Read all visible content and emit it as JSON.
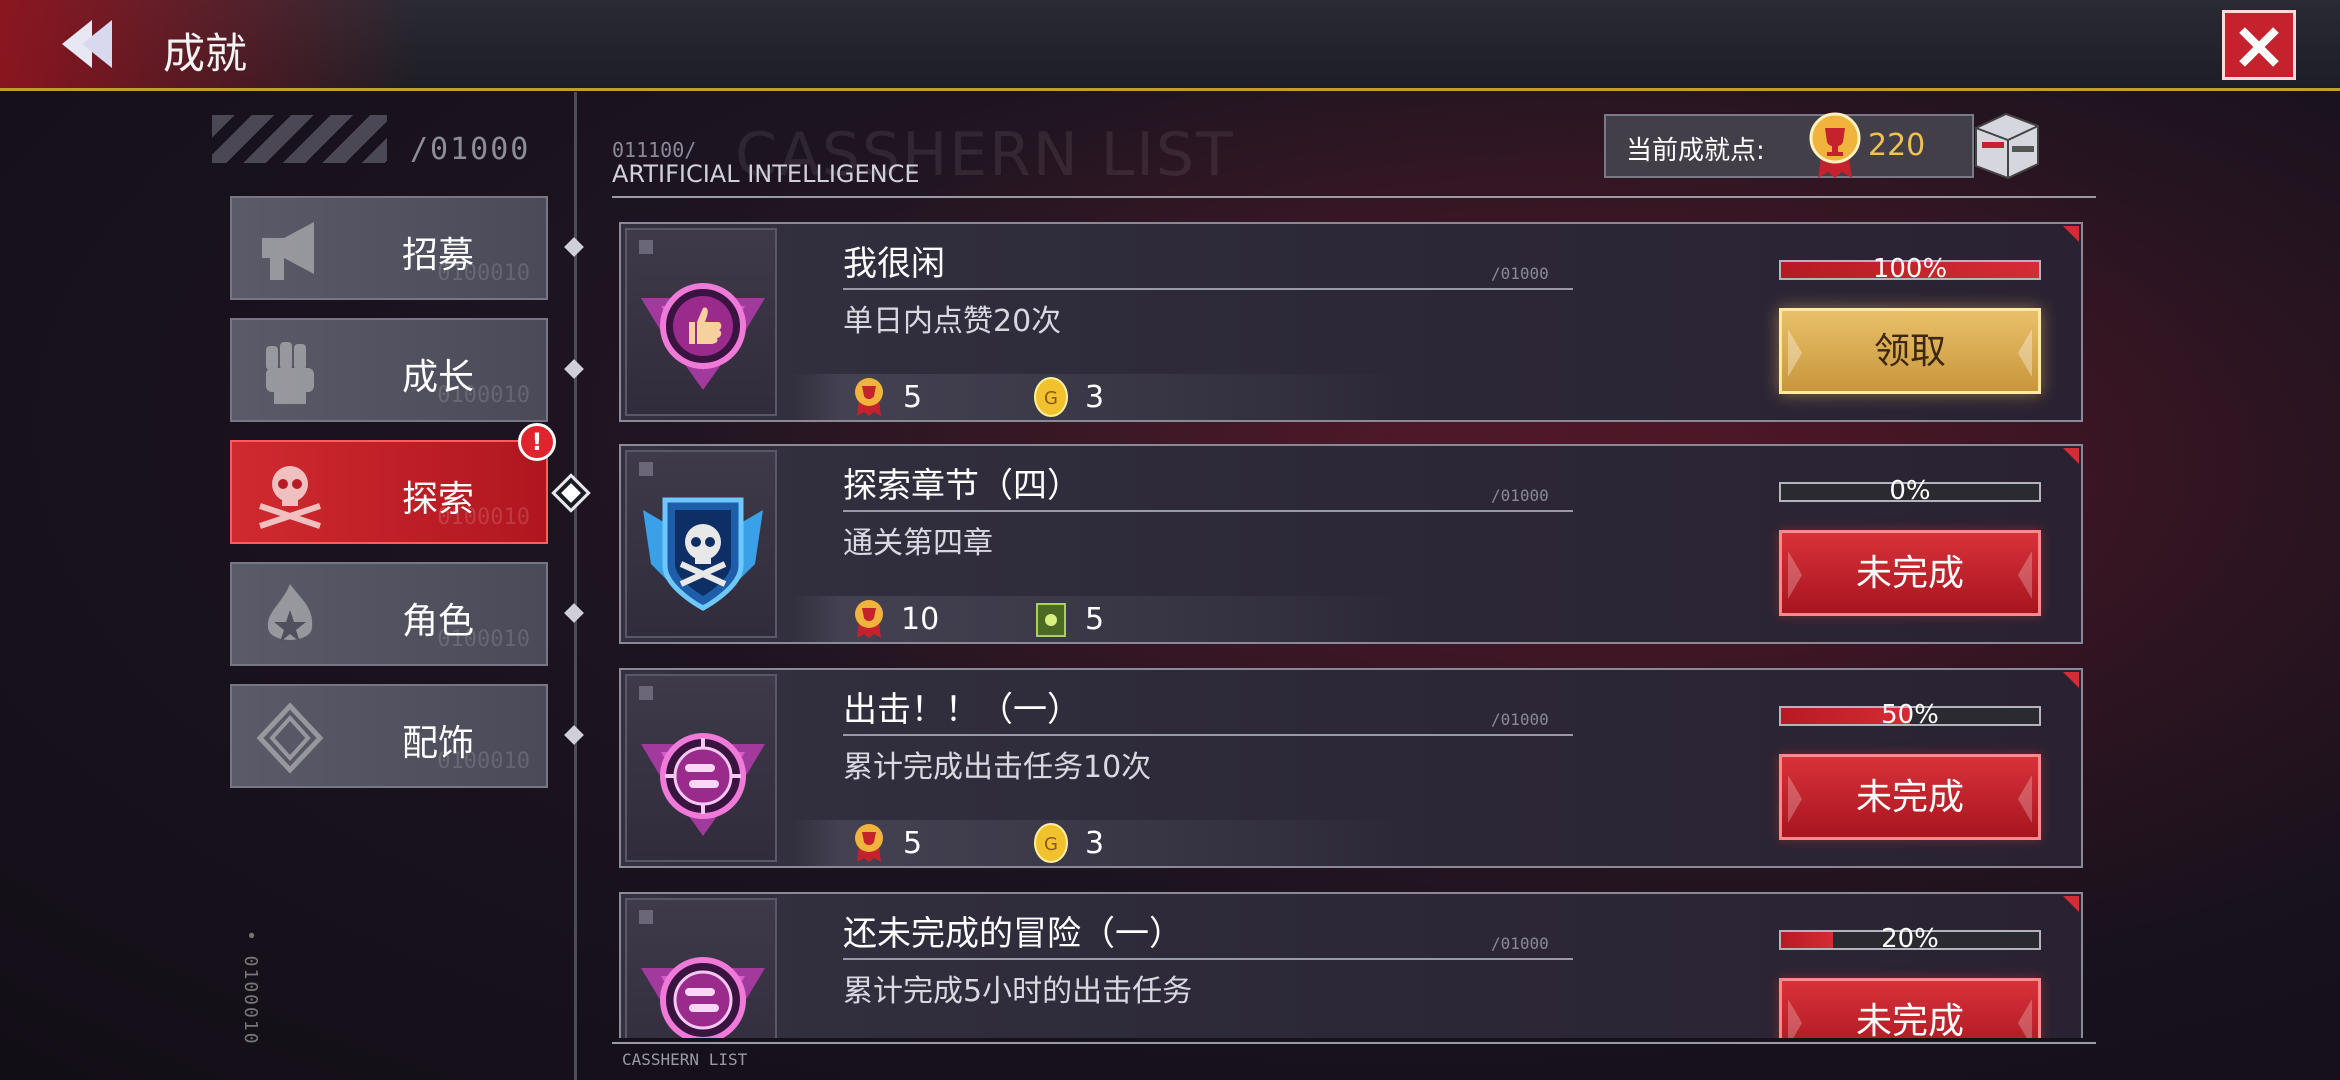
{
  "header": {
    "title": "成就"
  },
  "sidebar": {
    "code": "/01000",
    "vertical_code": "• 0100010",
    "tabs": [
      {
        "label": "招募",
        "icon": "megaphone-icon",
        "ghost": "0100010",
        "active": false
      },
      {
        "label": "成长",
        "icon": "fist-icon",
        "ghost": "0100010",
        "active": false
      },
      {
        "label": "探索",
        "icon": "skull-icon",
        "ghost": "0100010",
        "active": true,
        "alert": "!"
      },
      {
        "label": "角色",
        "icon": "flame-star-icon",
        "ghost": "0100010",
        "active": false
      },
      {
        "label": "配饰",
        "icon": "crystal-icon",
        "ghost": "0100010",
        "active": false
      }
    ]
  },
  "list_header": {
    "code": "011100/",
    "label": "ARTIFICIAL INTELLIGENCE",
    "bg_text": "CASSHERN LIST",
    "points_label": "当前成就点:",
    "points_value": "220"
  },
  "achievements": [
    {
      "title": "我很闲",
      "desc": "单日内点赞20次",
      "code": "/01000",
      "progress": 100,
      "progress_text": "100%",
      "rewards": [
        {
          "icon": "trophy-medal-icon",
          "value": "5"
        },
        {
          "icon": "gold-coin-icon",
          "value": "3"
        }
      ],
      "button": "领取",
      "state": "claim",
      "icon": "thumbs-up-badge-icon"
    },
    {
      "title": "探索章节（四）",
      "desc": "通关第四章",
      "code": "/01000",
      "progress": 0,
      "progress_text": "0%",
      "rewards": [
        {
          "icon": "trophy-medal-icon",
          "value": "10"
        },
        {
          "icon": "ammo-box-icon",
          "value": "5"
        }
      ],
      "button": "未完成",
      "state": "pending",
      "icon": "skull-shield-badge-icon"
    },
    {
      "title": "出击！！（一）",
      "desc": "累计完成出击任务10次",
      "code": "/01000",
      "progress": 50,
      "progress_text": "50%",
      "rewards": [
        {
          "icon": "trophy-medal-icon",
          "value": "5"
        },
        {
          "icon": "gold-coin-icon",
          "value": "3"
        }
      ],
      "button": "未完成",
      "state": "pending",
      "icon": "bullets-badge-icon"
    },
    {
      "title": "还未完成的冒险（一）",
      "desc": "累计完成5小时的出击任务",
      "code": "/01000",
      "progress": 20,
      "progress_text": "20%",
      "rewards": [],
      "button": "未完成",
      "state": "pending",
      "icon": "bullets-badge-icon"
    }
  ],
  "footer": {
    "label": "CASSHERN LIST"
  },
  "colors": {
    "accent_red": "#c6222e",
    "gold": "#f2c24e",
    "border": "#8a8a96"
  }
}
